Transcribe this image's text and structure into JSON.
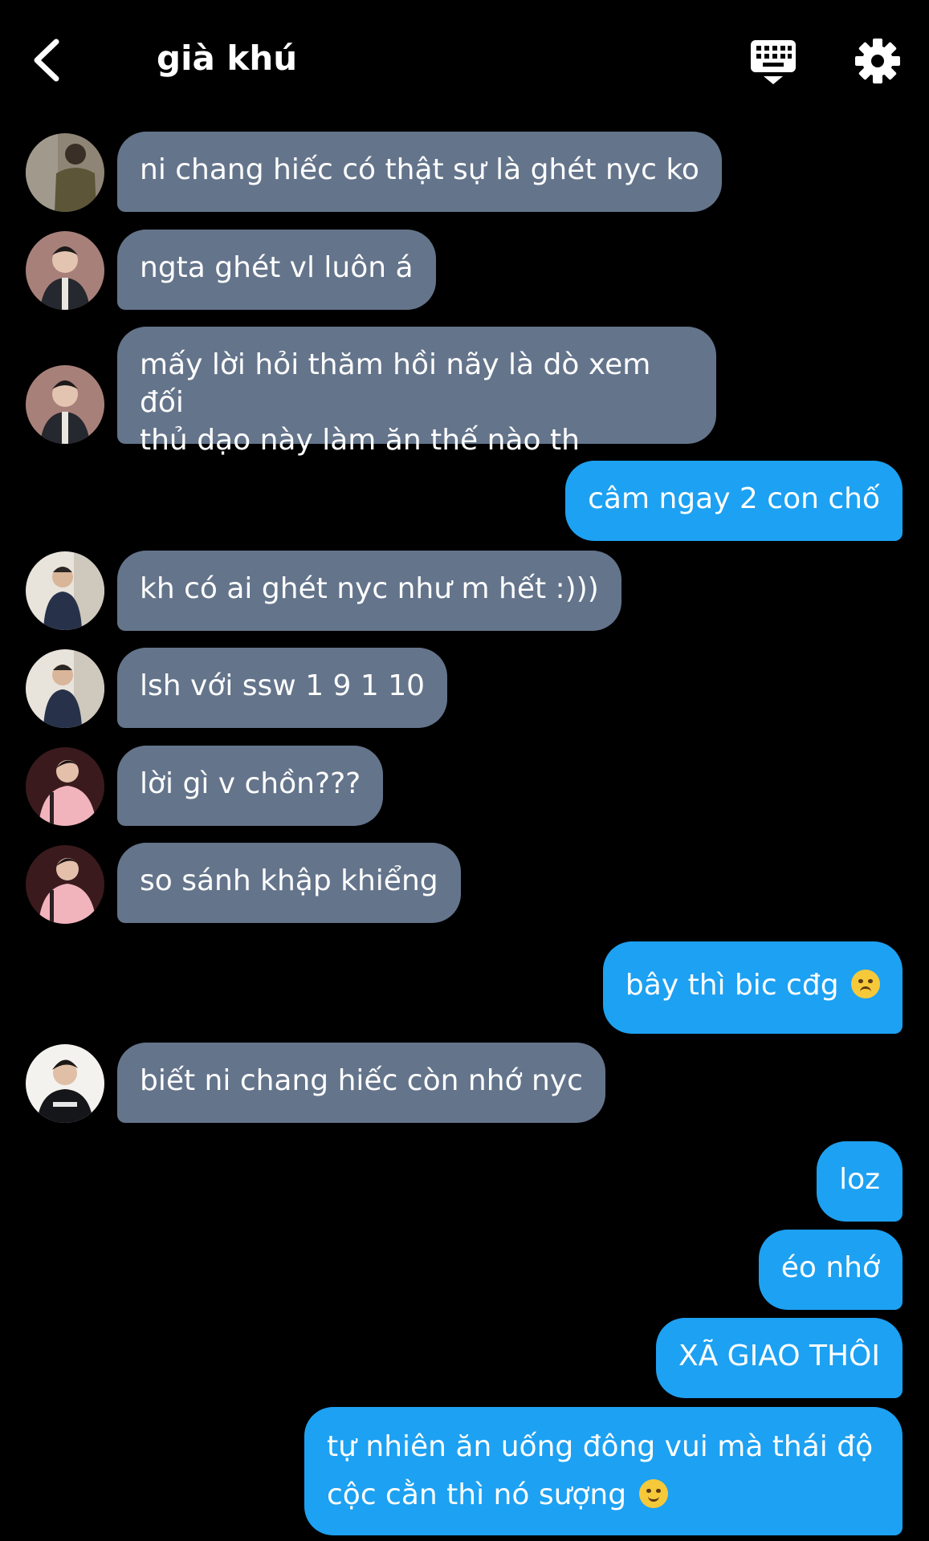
{
  "header": {
    "title": "già khú",
    "back_icon": "chevron-left-icon",
    "keyboard_icon": "keyboard-icon",
    "settings_icon": "gear-icon"
  },
  "colors": {
    "background": "#000000",
    "incoming_bubble": "#64748b",
    "outgoing_bubble": "#1da1f2",
    "text": "#ffffff"
  },
  "messages": [
    {
      "direction": "incoming",
      "text": "ni chang hiếc có thật sự là ghét nyc ko"
    },
    {
      "direction": "incoming",
      "text": "ngta ghét vl luôn á"
    },
    {
      "direction": "incoming",
      "lines": [
        "mấy lời hỏi thăm hồi nãy là dò xem đối",
        "thủ dạo này làm ăn thế nào th"
      ]
    },
    {
      "direction": "outgoing",
      "text": "câm ngay 2 con chố"
    },
    {
      "direction": "incoming",
      "text": "kh có ai ghét nyc như m hết :)))"
    },
    {
      "direction": "incoming",
      "text": "lsh với ssw 1 9 1 10"
    },
    {
      "direction": "incoming",
      "text": "lời gì v chồn???"
    },
    {
      "direction": "incoming",
      "text": "so sánh khập khiểng"
    },
    {
      "direction": "outgoing",
      "text": "bây thì bic cđg",
      "emoji": "unamused-face-emoji"
    },
    {
      "direction": "incoming",
      "text": "biết ni chang hiếc còn nhớ nyc"
    },
    {
      "direction": "outgoing",
      "text": "loz"
    },
    {
      "direction": "outgoing",
      "text": "éo nhớ"
    },
    {
      "direction": "outgoing",
      "text": "XÃ GIAO THÔI"
    },
    {
      "direction": "outgoing",
      "lines": [
        "tự nhiên ăn uống đông vui mà thái độ",
        "cộc cằn thì nó sượng"
      ],
      "emoji": "slightly-smiling-face-emoji"
    }
  ]
}
